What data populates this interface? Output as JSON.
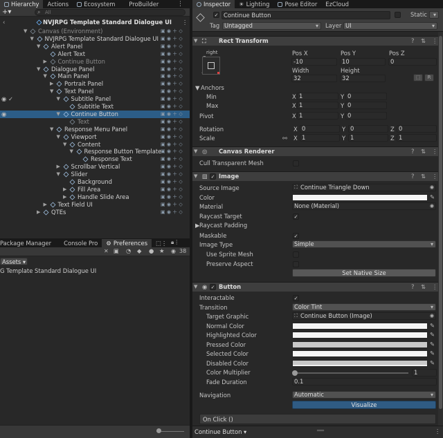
{
  "left_tabs": [
    "Hierarchy",
    "Actions",
    "Ecosystem",
    "ProBuilder"
  ],
  "hierarchy": {
    "search_placeholder": "All",
    "add_label": "+▾",
    "scene": "NVJRPG Template Standard Dialogue UI",
    "items": [
      {
        "label": "Canvas (Environment)",
        "depth": 1,
        "dim": true,
        "arrow": "▼"
      },
      {
        "label": "NVJRPG Template Standard Dialogue UI",
        "depth": 2,
        "dim": false,
        "arrow": "▼"
      },
      {
        "label": "Alert Panel",
        "depth": 3,
        "dim": false,
        "arrow": "▼"
      },
      {
        "label": "Alert Text",
        "depth": 4,
        "dim": false,
        "arrow": ""
      },
      {
        "label": "Continue Button",
        "depth": 4,
        "dim": true,
        "arrow": "▶"
      },
      {
        "label": "Dialogue Panel",
        "depth": 3,
        "dim": false,
        "arrow": "▼"
      },
      {
        "label": "Main Panel",
        "depth": 4,
        "dim": false,
        "arrow": "▼"
      },
      {
        "label": "Portrait Panel",
        "depth": 5,
        "dim": false,
        "arrow": "▶"
      },
      {
        "label": "Text Panel",
        "depth": 5,
        "dim": false,
        "arrow": "▼"
      },
      {
        "label": "Subtitle Panel",
        "depth": 6,
        "dim": false,
        "arrow": "▼"
      },
      {
        "label": "Subtitle Text",
        "depth": 7,
        "dim": false,
        "arrow": ""
      },
      {
        "label": "Continue Button",
        "depth": 6,
        "dim": false,
        "arrow": "▼",
        "selected": true
      },
      {
        "label": "Text",
        "depth": 7,
        "dim": true,
        "arrow": ""
      },
      {
        "label": "Response Menu Panel",
        "depth": 5,
        "dim": false,
        "arrow": "▼"
      },
      {
        "label": "Viewport",
        "depth": 6,
        "dim": false,
        "arrow": "▼"
      },
      {
        "label": "Content",
        "depth": 7,
        "dim": false,
        "arrow": "▼"
      },
      {
        "label": "Response Button Template",
        "depth": 8,
        "dim": false,
        "arrow": "▼"
      },
      {
        "label": "Response Text",
        "depth": 9,
        "dim": false,
        "arrow": ""
      },
      {
        "label": "Scrollbar Vertical",
        "depth": 6,
        "dim": false,
        "arrow": "▶"
      },
      {
        "label": "Slider",
        "depth": 6,
        "dim": false,
        "arrow": "▼"
      },
      {
        "label": "Background",
        "depth": 7,
        "dim": false,
        "arrow": ""
      },
      {
        "label": "Fill Area",
        "depth": 7,
        "dim": false,
        "arrow": "▶"
      },
      {
        "label": "Handle Slide Area",
        "depth": 7,
        "dim": false,
        "arrow": "▶"
      },
      {
        "label": "Text Field UI",
        "depth": 4,
        "dim": false,
        "arrow": "▶"
      },
      {
        "label": "QTEs",
        "depth": 3,
        "dim": false,
        "arrow": "▶"
      }
    ]
  },
  "project_tabs": [
    "Package Manager",
    "Console Pro",
    "Preferences"
  ],
  "project": {
    "assets_label": "Assets ▾",
    "asset_path": "G Template Standard Dialogue UI",
    "hidden_count": "38"
  },
  "right_tabs": [
    "Inspector",
    "Lighting",
    "Pose Editor",
    "EzCloud"
  ],
  "inspector": {
    "object_name": "Continue Button",
    "static_label": "Static",
    "tag_label": "Tag",
    "tag_value": "Untagged",
    "layer_label": "Layer",
    "layer_value": "UI",
    "rect": {
      "title": "Rect Transform",
      "anchor_h": "right",
      "anchor_v": "bottom",
      "posx_label": "Pos X",
      "posy_label": "Pos Y",
      "posz_label": "Pos Z",
      "posx": "-10",
      "posy": "10",
      "posz": "0",
      "width_label": "Width",
      "height_label": "Height",
      "width": "32",
      "height": "32",
      "anchors_label": "Anchors",
      "min_label": "Min",
      "max_label": "Max",
      "min_x": "1",
      "min_y": "0",
      "max_x": "1",
      "max_y": "0",
      "pivot_label": "Pivot",
      "pivot_x": "1",
      "pivot_y": "0",
      "rotation_label": "Rotation",
      "rot_x": "0",
      "rot_y": "0",
      "rot_z": "0",
      "scale_label": "Scale",
      "scale_x": "1",
      "scale_y": "1",
      "scale_z": "1",
      "x": "X",
      "y": "Y",
      "z": "Z",
      "r": "R"
    },
    "canvas_renderer": {
      "title": "Canvas Renderer",
      "cull_label": "Cull Transparent Mesh"
    },
    "image": {
      "title": "Image",
      "source_label": "Source Image",
      "source_value": "Continue Triangle Down",
      "color_label": "Color",
      "material_label": "Material",
      "material_value": "None (Material)",
      "raycast_label": "Raycast Target",
      "padding_label": "Raycast Padding",
      "maskable_label": "Maskable",
      "type_label": "Image Type",
      "type_value": "Simple",
      "sprite_mesh_label": "Use Sprite Mesh",
      "preserve_label": "Preserve Aspect",
      "native_button": "Set Native Size"
    },
    "button": {
      "title": "Button",
      "interactable_label": "Interactable",
      "transition_label": "Transition",
      "transition_value": "Color Tint",
      "target_label": "Target Graphic",
      "target_value": "Continue Button (Image)",
      "normal_label": "Normal Color",
      "highlighted_label": "Highlighted Color",
      "pressed_label": "Pressed Color",
      "selected_label": "Selected Color",
      "disabled_label": "Disabled Color",
      "multiplier_label": "Color Multiplier",
      "multiplier_value": "1",
      "fade_label": "Fade Duration",
      "fade_value": "0.1",
      "navigation_label": "Navigation",
      "navigation_value": "Automatic",
      "visualize_label": "Visualize",
      "onclick_label": "On Click ()"
    },
    "footer_label": "Continue Button ▾"
  },
  "colors": {
    "accent": "#2c5d87",
    "visualize": "#2f5b84",
    "white_swatch": "#f5f5f5",
    "pressed_swatch": "#c8c8c8",
    "disabled_swatch": "#c8c8c8"
  }
}
